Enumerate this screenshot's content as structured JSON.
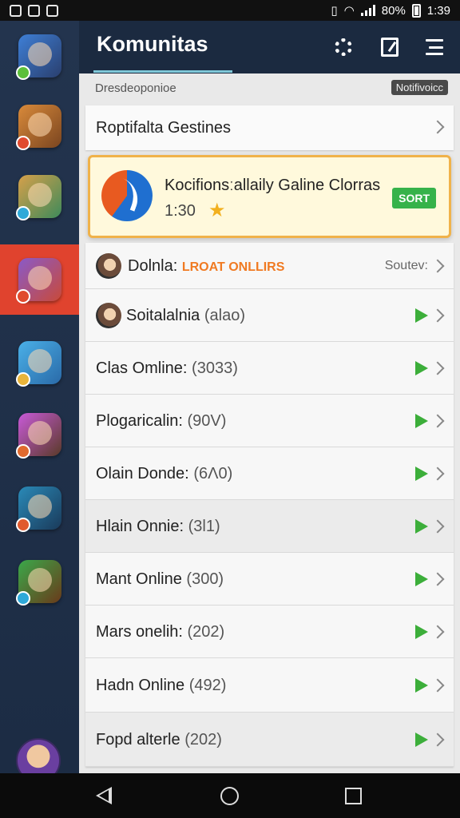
{
  "status_bar": {
    "battery_text": "80%",
    "time": "1:39",
    "left_icons": [
      "gallery-icon",
      "mail-icon",
      "app-icon"
    ],
    "right_icons": [
      "vibrate-icon",
      "wifi-icon",
      "signal-icon",
      "battery-icon"
    ]
  },
  "app_bar": {
    "title": "Komunitas",
    "actions": [
      "settings-icon",
      "edit-icon",
      "menu-icon"
    ],
    "underline_color": "#7fc8d8"
  },
  "sidebar": {
    "active_index": 3,
    "active_color": "#e0432e",
    "items": [
      {
        "name": "game-1",
        "colors": [
          "#3e7fd6",
          "#2a3f6e"
        ],
        "badge": "#5bbf3a"
      },
      {
        "name": "game-2",
        "colors": [
          "#d98a3a",
          "#7a4520"
        ],
        "badge": "#e04a2e"
      },
      {
        "name": "game-3",
        "colors": [
          "#d6a04a",
          "#3e8a5a"
        ],
        "badge": "#2fa9d8"
      },
      {
        "name": "game-4",
        "colors": [
          "#8a5ac8",
          "#c84a3a"
        ],
        "badge": "#e04a2e"
      },
      {
        "name": "game-5",
        "colors": [
          "#4ab0e8",
          "#2a6aa8"
        ],
        "badge": "#e8b43a"
      },
      {
        "name": "game-6",
        "colors": [
          "#c85ad8",
          "#5a3a28"
        ],
        "badge": "#e06a2e"
      },
      {
        "name": "game-7",
        "colors": [
          "#2a8ab8",
          "#1a3a5a"
        ],
        "badge": "#e05a2e"
      },
      {
        "name": "game-8",
        "colors": [
          "#3aa84a",
          "#6a3a1a"
        ],
        "badge": "#2fa9d8"
      }
    ]
  },
  "subheader": {
    "text": "Dresdeoponioe",
    "badge": "Notifivoicc"
  },
  "section_header": {
    "label": "Roptifalta Gestines"
  },
  "featured": {
    "title": "Kocifionsːallaily Galine Clorras",
    "rating": "1:30",
    "star": "★",
    "button": "SORT",
    "button_color": "#36b24a",
    "border_color": "#f0b24a"
  },
  "list": [
    {
      "label": "Dolnla:",
      "highlight": "LROAT ONLLIRS",
      "status": "Soutev:",
      "has_avatar": true,
      "has_play": false,
      "shade": false
    },
    {
      "label": "Soitalalnia",
      "count": "(alao)",
      "has_avatar": true,
      "has_play": true,
      "shade": false
    },
    {
      "label": "Clas Omline:",
      "count": "(3033)",
      "has_avatar": false,
      "has_play": true,
      "shade": false
    },
    {
      "label": "Plogaricalin:",
      "count": "(90V)",
      "has_avatar": false,
      "has_play": true,
      "shade": false
    },
    {
      "label": "Olain Donde:",
      "count": "(6Λ0)",
      "has_avatar": false,
      "has_play": true,
      "shade": false
    },
    {
      "label": "Hlain Onnie:",
      "count": "(3Ɩ1)",
      "has_avatar": false,
      "has_play": true,
      "shade": true
    },
    {
      "label": "Mant Online",
      "count": "(300)",
      "has_avatar": false,
      "has_play": true,
      "shade": false
    },
    {
      "label": "Mars onelih:",
      "count": "(202)",
      "has_avatar": false,
      "has_play": true,
      "shade": false
    },
    {
      "label": "Hadn Online",
      "count": "(492)",
      "has_avatar": false,
      "has_play": true,
      "shade": false
    },
    {
      "label": "Fopd alterle",
      "count": "(202)",
      "has_avatar": false,
      "has_play": true,
      "shade": true
    }
  ],
  "nav_bar": {
    "buttons": [
      "back-icon",
      "home-icon",
      "recents-icon"
    ]
  }
}
